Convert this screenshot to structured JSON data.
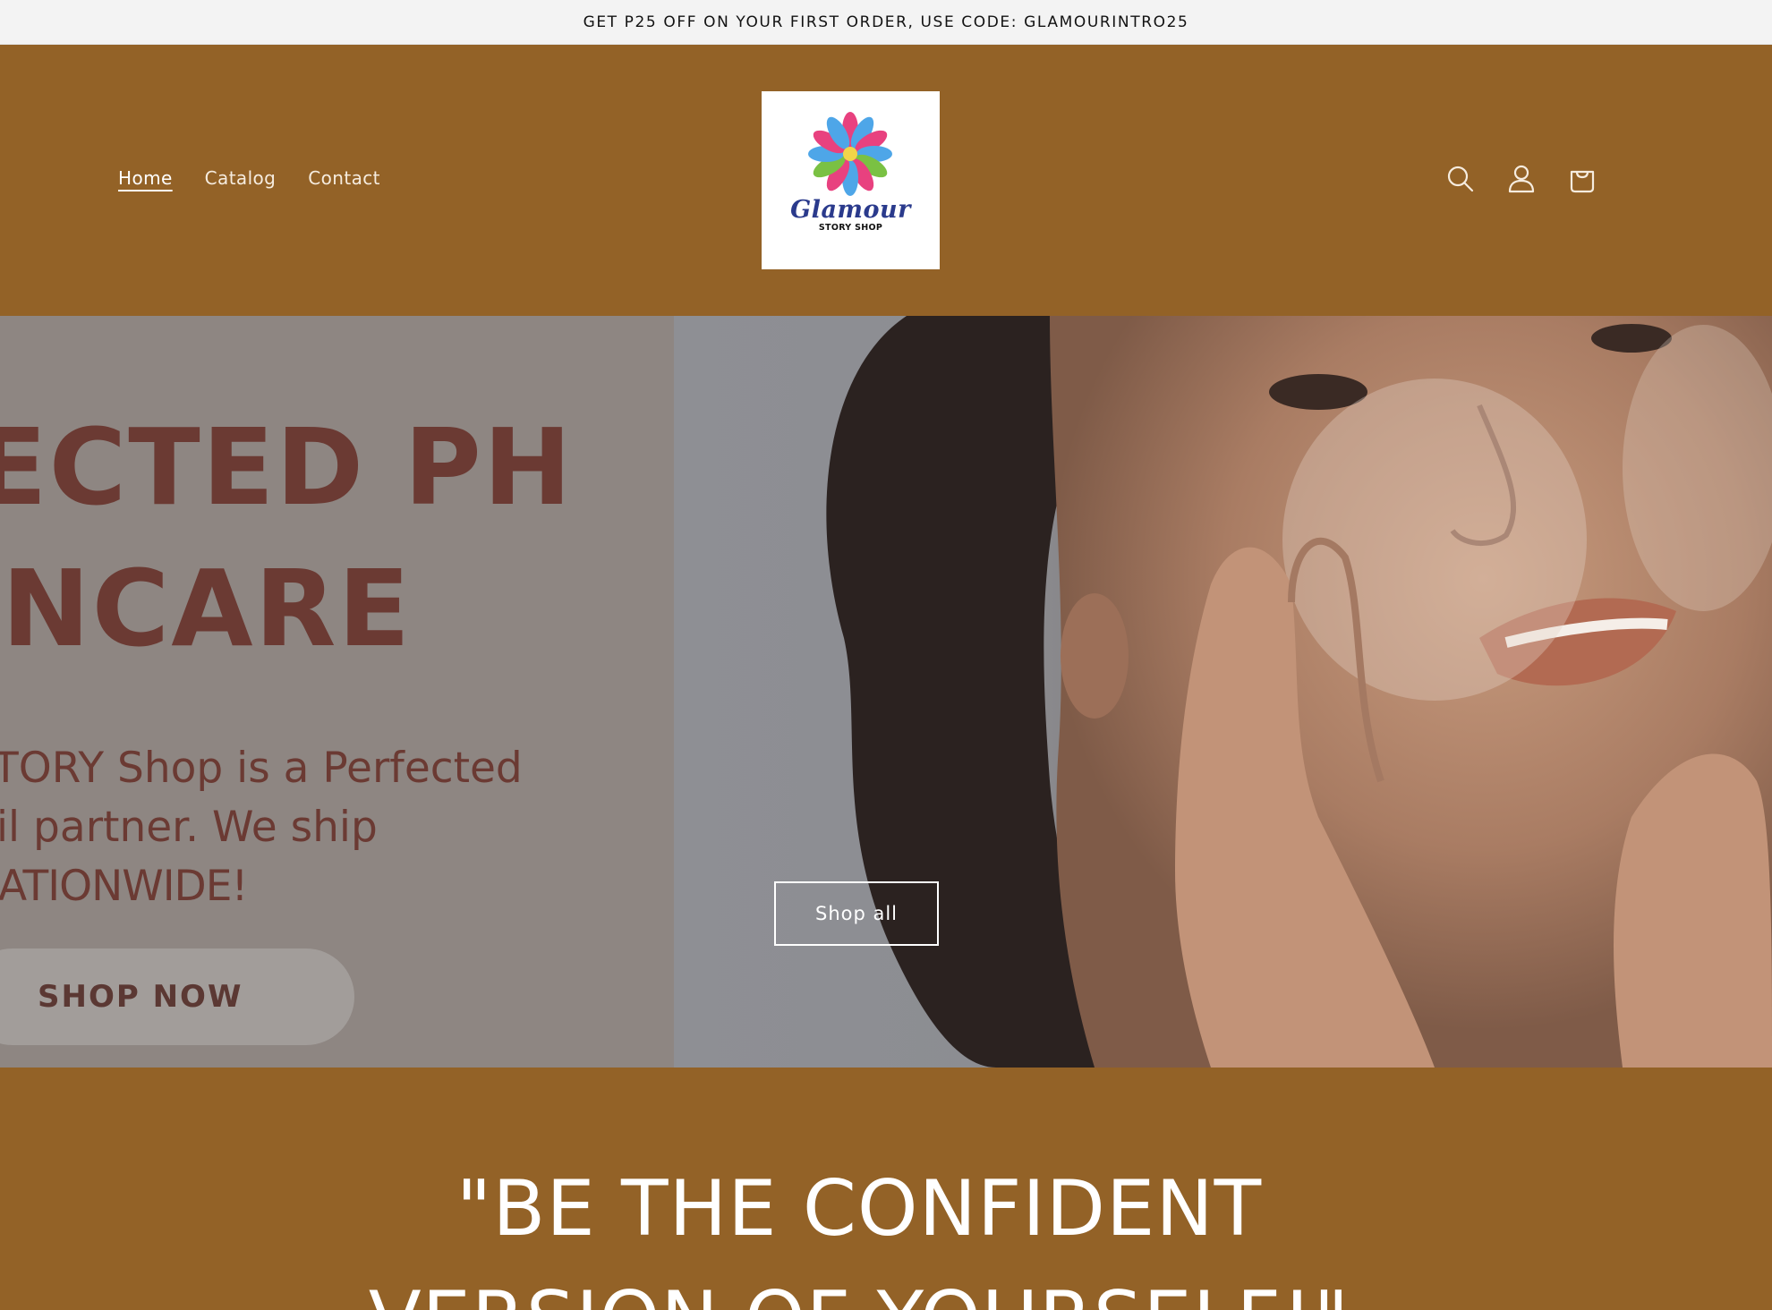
{
  "announcement": {
    "text": "GET P25 OFF ON YOUR FIRST ORDER, USE CODE: GLAMOURINTRO25"
  },
  "header": {
    "nav": [
      {
        "label": "Home",
        "active": true
      },
      {
        "label": "Catalog",
        "active": false
      },
      {
        "label": "Contact",
        "active": false
      }
    ],
    "logo": {
      "word": "Glamour",
      "sub": "STORY SHOP"
    },
    "icons": [
      "search-icon",
      "account-icon",
      "cart-icon"
    ],
    "background_color": "#936227"
  },
  "hero": {
    "headline_line1": "ECTED PH",
    "headline_line2": "INCARE",
    "body_line1": "TORY Shop is a Perfected",
    "body_line2": "il partner. We ship",
    "body_line3": "ATIONWIDE!",
    "shop_now_label": "SHOP NOW",
    "shop_all_label": "Shop all"
  },
  "tagline": {
    "line1": "\"BE THE CONFIDENT",
    "line2": "VERSION OF YOURSELF!\""
  }
}
